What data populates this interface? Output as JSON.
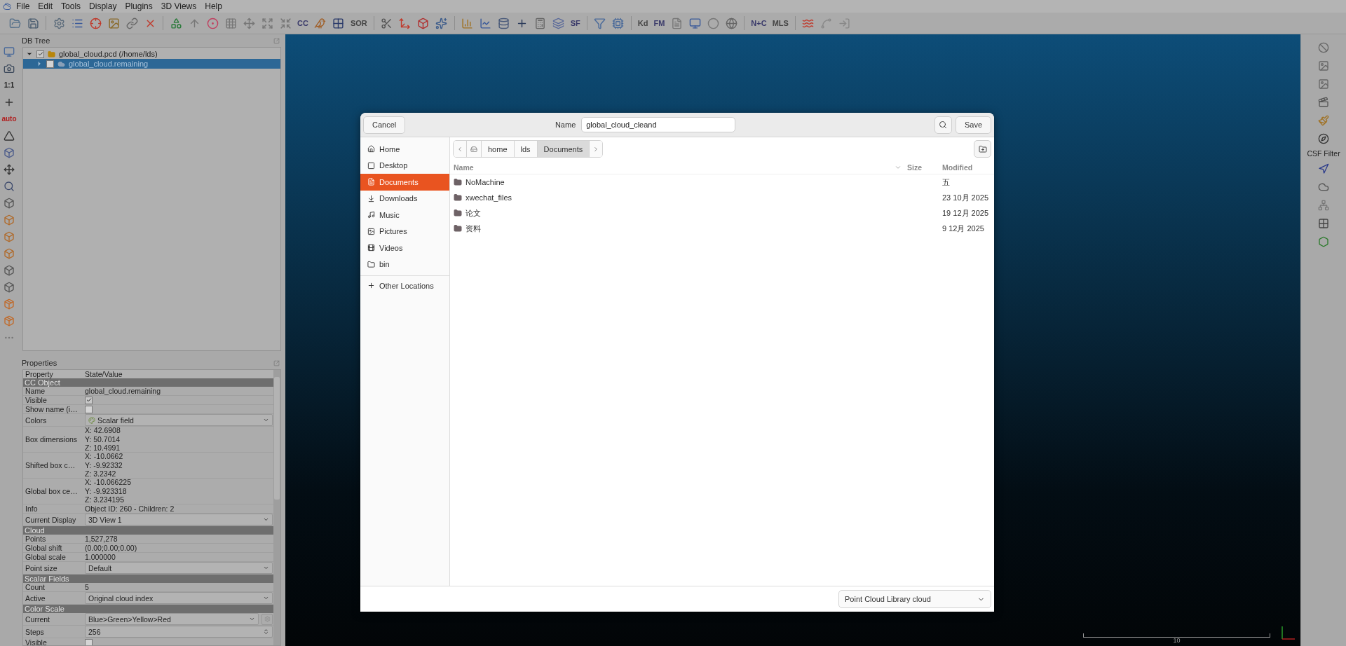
{
  "menu": [
    "File",
    "Edit",
    "Tools",
    "Display",
    "Plugins",
    "3D Views",
    "Help"
  ],
  "toolbar": [
    {
      "kind": "icon"
    },
    {
      "kind": "icon"
    },
    {
      "kind": "sep"
    },
    {
      "kind": "icon"
    },
    {
      "kind": "icon"
    },
    {
      "kind": "icon"
    },
    {
      "kind": "icon"
    },
    {
      "kind": "icon"
    },
    {
      "kind": "icon"
    },
    {
      "kind": "sep"
    },
    {
      "kind": "icon"
    },
    {
      "kind": "icon"
    },
    {
      "kind": "icon"
    },
    {
      "kind": "icon"
    },
    {
      "kind": "icon"
    },
    {
      "kind": "icon"
    },
    {
      "kind": "icon"
    },
    {
      "kind": "text",
      "label": "CC"
    },
    {
      "kind": "icon"
    },
    {
      "kind": "icon"
    },
    {
      "kind": "text",
      "label": "SOR"
    },
    {
      "kind": "sep"
    },
    {
      "kind": "icon"
    },
    {
      "kind": "icon"
    },
    {
      "kind": "icon"
    },
    {
      "kind": "icon"
    },
    {
      "kind": "sep"
    },
    {
      "kind": "icon"
    },
    {
      "kind": "icon"
    },
    {
      "kind": "icon"
    },
    {
      "kind": "icon"
    },
    {
      "kind": "icon"
    },
    {
      "kind": "icon"
    },
    {
      "kind": "text",
      "label": "SF"
    },
    {
      "kind": "sep"
    },
    {
      "kind": "icon"
    },
    {
      "kind": "icon"
    },
    {
      "kind": "sep"
    },
    {
      "kind": "text",
      "label": "Kd"
    },
    {
      "kind": "text",
      "label": "FM"
    },
    {
      "kind": "icon"
    },
    {
      "kind": "icon"
    },
    {
      "kind": "icon"
    },
    {
      "kind": "icon"
    },
    {
      "kind": "sep"
    },
    {
      "kind": "text",
      "label": "N+C"
    },
    {
      "kind": "text",
      "label": "MLS"
    },
    {
      "kind": "sep"
    },
    {
      "kind": "icon"
    },
    {
      "kind": "icon"
    },
    {
      "kind": "icon"
    }
  ],
  "left_toolbar": [
    {
      "kind": "icon"
    },
    {
      "kind": "icon"
    },
    {
      "kind": "text",
      "label": "1:1"
    },
    {
      "kind": "icon"
    },
    {
      "kind": "text",
      "label": "auto"
    },
    {
      "kind": "icon"
    },
    {
      "kind": "icon"
    },
    {
      "kind": "icon"
    },
    {
      "kind": "icon"
    },
    {
      "kind": "icon"
    },
    {
      "kind": "icon"
    },
    {
      "kind": "icon"
    },
    {
      "kind": "icon"
    },
    {
      "kind": "icon"
    },
    {
      "kind": "icon"
    },
    {
      "kind": "icon"
    },
    {
      "kind": "icon"
    },
    {
      "kind": "icon"
    }
  ],
  "db_tree": {
    "title": "DB Tree",
    "items": [
      {
        "label": "global_cloud.pcd (/home/lds)",
        "expanded": true,
        "checked": true,
        "selected": false,
        "children": [
          {
            "label": "global_cloud.remaining",
            "expanded": false,
            "checked": false,
            "selected": true
          }
        ]
      }
    ]
  },
  "properties": {
    "title": "Properties",
    "columns": [
      "Property",
      "State/Value"
    ],
    "rows": [
      {
        "kind": "section",
        "label": "CC Object"
      },
      {
        "kind": "text",
        "label": "Name",
        "value": "global_cloud.remaining"
      },
      {
        "kind": "check",
        "label": "Visible",
        "checked": true
      },
      {
        "kind": "check",
        "label": "Show name (i…",
        "checked": false
      },
      {
        "kind": "combo",
        "label": "Colors",
        "value": "Scalar field"
      },
      {
        "kind": "multi",
        "label": "Box dimensions",
        "lines": [
          "X: 42.6908",
          "Y: 50.7014",
          "Z: 10.4991"
        ]
      },
      {
        "kind": "multi",
        "label": "Shifted box c…",
        "lines": [
          "X: -10.0662",
          "Y: -9.92332",
          "Z: 3.2342"
        ]
      },
      {
        "kind": "multi",
        "label": "Global box ce…",
        "lines": [
          "X: -10.066225",
          "Y: -9.923318",
          "Z: 3.234195"
        ]
      },
      {
        "kind": "text",
        "label": "Info",
        "value": "Object ID: 260 - Children: 2"
      },
      {
        "kind": "combo",
        "label": "Current Display",
        "value": "3D View 1"
      },
      {
        "kind": "section",
        "label": "Cloud"
      },
      {
        "kind": "text",
        "label": "Points",
        "value": "1,527,278"
      },
      {
        "kind": "text",
        "label": "Global shift",
        "value": "(0.00;0.00;0.00)"
      },
      {
        "kind": "text",
        "label": "Global scale",
        "value": "1.000000"
      },
      {
        "kind": "combo",
        "label": "Point size",
        "value": "Default"
      },
      {
        "kind": "section",
        "label": "Scalar Fields"
      },
      {
        "kind": "text",
        "label": "Count",
        "value": "5"
      },
      {
        "kind": "combo",
        "label": "Active",
        "value": "Original cloud index"
      },
      {
        "kind": "section",
        "label": "Color Scale"
      },
      {
        "kind": "combo_gear",
        "label": "Current",
        "value": "Blue>Green>Yellow>Red"
      },
      {
        "kind": "spin",
        "label": "Steps",
        "value": "256"
      },
      {
        "kind": "check",
        "label": "Visible",
        "checked": false
      }
    ]
  },
  "right_toolbar": [
    {
      "kind": "icon"
    },
    {
      "kind": "icon"
    },
    {
      "kind": "icon"
    },
    {
      "kind": "icon"
    },
    {
      "kind": "icon"
    },
    {
      "kind": "icon"
    },
    {
      "kind": "text",
      "label": "CSF Filter"
    },
    {
      "kind": "icon"
    },
    {
      "kind": "icon"
    },
    {
      "kind": "icon"
    },
    {
      "kind": "icon"
    },
    {
      "kind": "icon"
    }
  ],
  "view": {
    "scale_label": "10"
  },
  "dialog": {
    "cancel": "Cancel",
    "name_label": "Name",
    "name_value": "global_cloud_cleand",
    "save": "Save",
    "places": [
      {
        "label": "Home",
        "selected": false
      },
      {
        "label": "Desktop",
        "selected": false
      },
      {
        "label": "Documents",
        "selected": true
      },
      {
        "label": "Downloads",
        "selected": false
      },
      {
        "label": "Music",
        "selected": false
      },
      {
        "label": "Pictures",
        "selected": false
      },
      {
        "label": "Videos",
        "selected": false
      },
      {
        "label": "bin",
        "selected": false
      }
    ],
    "other_locations": "Other Locations",
    "path": [
      {
        "label": "home",
        "selected": false
      },
      {
        "label": "lds",
        "selected": false
      },
      {
        "label": "Documents",
        "selected": true
      }
    ],
    "columns": [
      "Name",
      "Size",
      "Modified"
    ],
    "files": [
      {
        "name": "NoMachine",
        "modified": "五"
      },
      {
        "name": "xwechat_files",
        "modified": "23 10月 2025"
      },
      {
        "name": "论文",
        "modified": "19 12月 2025"
      },
      {
        "name": "资料",
        "modified": "9 12月 2025"
      }
    ],
    "filter": "Point Cloud Library cloud"
  }
}
